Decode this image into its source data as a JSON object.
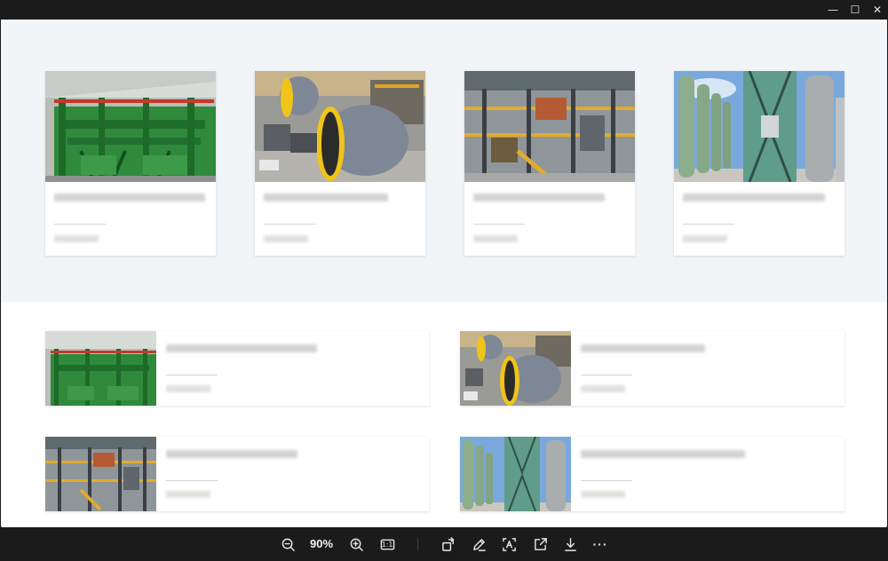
{
  "window": {
    "minimize_glyph": "—",
    "maximize_glyph": "☐",
    "close_glyph": "✕"
  },
  "toolbar": {
    "zoom_level": "90%",
    "actual_size_label": "1:1",
    "more_glyph": "···"
  },
  "icons": {
    "zoom_out": "zoom-out-icon",
    "zoom_in": "zoom-in-icon",
    "rotate": "rotate-icon",
    "edit": "edit-icon",
    "text_recognition": "text-recognition-icon",
    "share": "share-icon",
    "download": "download-icon",
    "more": "more-icon"
  },
  "colors": {
    "toolbar_bg": "#1b1b1b",
    "upper_section_bg": "#f2f5f7",
    "card_bg": "#ffffff",
    "divider": "#cfd6e0"
  }
}
